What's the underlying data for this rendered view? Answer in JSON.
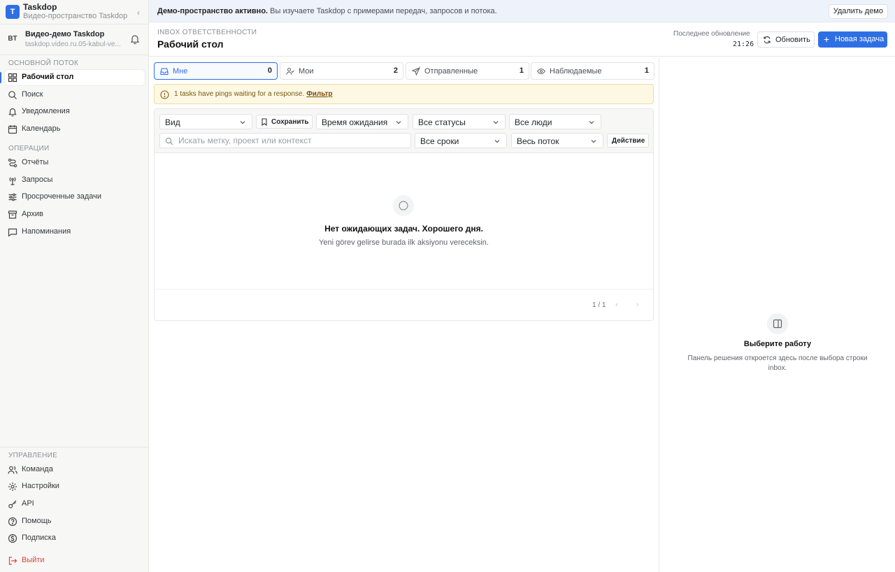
{
  "brand": {
    "logo_letter": "T",
    "name": "Taskdop",
    "subtitle": "Видео-пространство Taskdop",
    "collapse_glyph": "‹"
  },
  "workspace": {
    "badge": "BT",
    "name": "Видео-демо Taskdop",
    "url": "taskdop.video.ru.05-kabul-ve..."
  },
  "sidebar": {
    "section_main": "ОСНОВНОЙ ПОТОК",
    "main_items": [
      {
        "label": "Рабочий стол",
        "icon": "grid-icon"
      },
      {
        "label": "Поиск",
        "icon": "search-icon"
      },
      {
        "label": "Уведомления",
        "icon": "bell-icon"
      },
      {
        "label": "Календарь",
        "icon": "calendar-icon"
      }
    ],
    "section_ops": "ОПЕРАЦИИ",
    "ops_items": [
      {
        "label": "Отчёты",
        "icon": "route-icon"
      },
      {
        "label": "Запросы",
        "icon": "antenna-icon"
      },
      {
        "label": "Просроченные задачи",
        "icon": "sliders-icon"
      },
      {
        "label": "Архив",
        "icon": "archive-icon"
      },
      {
        "label": "Напоминания",
        "icon": "message-icon"
      }
    ],
    "section_admin": "УПРАВЛЕНИЕ",
    "admin_items": [
      {
        "label": "Команда",
        "icon": "users-icon"
      },
      {
        "label": "Настройки",
        "icon": "gear-icon"
      },
      {
        "label": "API",
        "icon": "key-icon"
      },
      {
        "label": "Помощь",
        "icon": "help-icon"
      },
      {
        "label": "Подписка",
        "icon": "dollar-icon"
      }
    ],
    "logout": {
      "label": "Выйти",
      "icon": "logout-icon",
      "color": "#d9453a"
    }
  },
  "demo_banner": {
    "bold": "Демо-пространство активно.",
    "text": " Вы изучаете Taskdop с примерами передач, запросов и потока.",
    "delete_label": "Удалить демо"
  },
  "header": {
    "kicker": "INBOX ОТВЕТСТВЕННОСТИ",
    "title": "Рабочий стол",
    "updated_label": "Последнее обновление",
    "updated_time": "21:26",
    "refresh_label": "Обновить",
    "new_task_label": "Новая задача"
  },
  "tabs": [
    {
      "label": "Мне",
      "count": "0",
      "icon": "inbox-icon"
    },
    {
      "label": "Мои",
      "count": "2",
      "icon": "user-check-icon"
    },
    {
      "label": "Отправленные",
      "count": "1",
      "icon": "send-icon"
    },
    {
      "label": "Наблюдаемые",
      "count": "1",
      "icon": "eye-icon"
    }
  ],
  "alert": {
    "text": "1 tasks have pings waiting for a response.",
    "link": "Фильтр"
  },
  "filters": {
    "view": "Вид",
    "save": "Сохранить",
    "wait_time": "Время ожидания",
    "statuses": "Все статусы",
    "people": "Все люди",
    "search_placeholder": "Искать метку, проект или контекст",
    "deadlines": "Все сроки",
    "flow": "Весь поток",
    "action": "Действие"
  },
  "empty": {
    "title": "Нет ожидающих задач. Хорошего дня.",
    "subtitle": "Yeni görev gelirse burada ilk aksiyonu vereceksin."
  },
  "pagination": {
    "text": "1 / 1",
    "prev": "‹",
    "next": "›"
  },
  "detail_panel": {
    "title": "Выберите работу",
    "description": "Панель решения откроется здесь после выбора строки inbox."
  },
  "colors": {
    "accent": "#2f6fe4",
    "alert_bg": "#fdf8e4",
    "danger": "#d9453a"
  }
}
